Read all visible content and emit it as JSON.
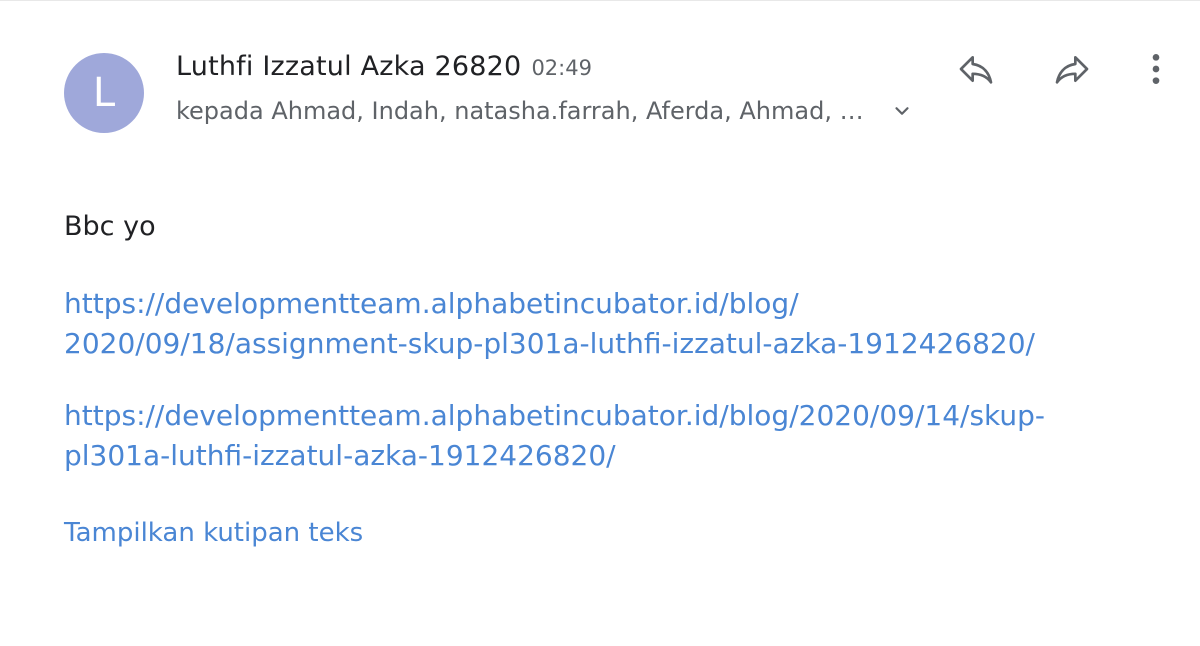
{
  "message": {
    "avatar_initial": "L",
    "avatar_color": "#9fa8da",
    "sender_name": "Luthfi Izzatul Azka 26820",
    "time": "02:49",
    "recipients": "kepada Ahmad, Indah, natasha.farrah, Aferda, Ahmad, …",
    "body_text": "Bbc yo",
    "links": [
      {
        "line1": "https://developmentteam.alphabetincubator.id/blog/",
        "line2": "2020/09/18/assignment-skup-pl301a-luthfi-izzatul-azka-1912426820/"
      },
      {
        "line1": "https://developmentteam.alphabetincubator.id/blog/2020/09/14/skup-",
        "line2": "pl301a-luthfi-izzatul-azka-1912426820/"
      }
    ],
    "show_quoted_label": "Tampilkan kutipan teks"
  },
  "actions": {
    "reply_icon": "reply-icon",
    "forward_icon": "forward-icon",
    "more_icon": "more-vert-icon",
    "expand_icon": "chevron-down-icon"
  },
  "colors": {
    "link": "#4a86d4",
    "primary_text": "#202124",
    "secondary_text": "#5f6368"
  }
}
